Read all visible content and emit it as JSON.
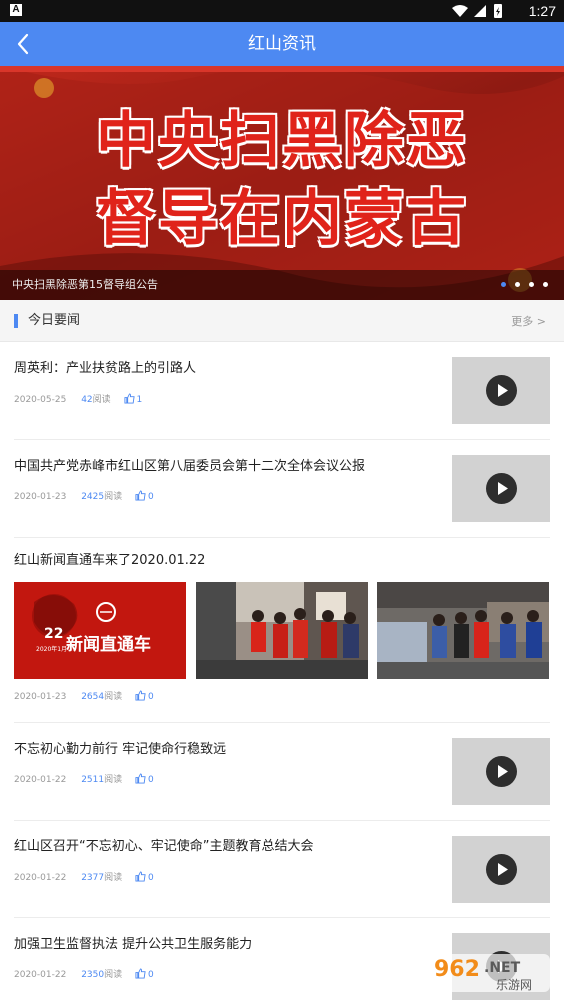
{
  "status_bar": {
    "notification_icon": "A",
    "time": "1:27",
    "icons": [
      "wifi-icon",
      "signal-icon",
      "battery-charging-icon"
    ]
  },
  "header": {
    "title": "红山资讯",
    "back_icon": "chevron-left-icon"
  },
  "banner": {
    "headline_line1": "中央扫黑除恶",
    "headline_line2": "督导在内蒙古",
    "caption": "中央扫黑除恶第15督导组公告",
    "slide_count": 4,
    "active_slide": 1
  },
  "section": {
    "title": "今日要闻",
    "more_label": "更多 >"
  },
  "news": [
    {
      "title": "周英利：产业扶贫路上的引路人",
      "date": "2020-05-25",
      "reads": "42",
      "reads_label": "阅读",
      "likes": "1",
      "media": "video"
    },
    {
      "title": "中国共产党赤峰市红山区第八届委员会第十二次全体会议公报",
      "date": "2020-01-23",
      "reads": "2425",
      "reads_label": "阅读",
      "likes": "0",
      "media": "video"
    },
    {
      "title": "红山新闻直通车来了2020.01.22",
      "date": "2020-01-23",
      "reads": "2654",
      "reads_label": "阅读",
      "likes": "0",
      "media": "photos",
      "photo_text": {
        "day": "22",
        "sub": "2020年1月",
        "label": "新闻直通车"
      }
    },
    {
      "title": "不忘初心勤力前行 牢记使命行稳致远",
      "date": "2020-01-22",
      "reads": "2511",
      "reads_label": "阅读",
      "likes": "0",
      "media": "video"
    },
    {
      "title": "红山区召开“不忘初心、牢记使命”主题教育总结大会",
      "date": "2020-01-22",
      "reads": "2377",
      "reads_label": "阅读",
      "likes": "0",
      "media": "video"
    },
    {
      "title": "加强卫生监督执法 提升公共卫生服务能力",
      "date": "2020-01-22",
      "reads": "2350",
      "reads_label": "阅读",
      "likes": "0",
      "media": "video"
    }
  ],
  "watermark": {
    "logo_text": "962.NET",
    "sub_text": "乐游网"
  },
  "colors": {
    "accent": "#4d89f2",
    "banner_red": "#e0231a",
    "thumb_bg": "#d2d2d2"
  }
}
